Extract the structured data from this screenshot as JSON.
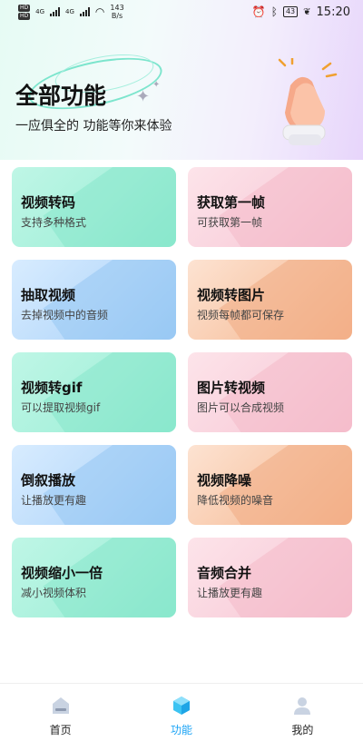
{
  "status_bar": {
    "hd1": "HD",
    "hd2": "HD",
    "net1": "4G",
    "net2": "4G",
    "speed_value": "143",
    "speed_unit": "B/s",
    "battery": "43",
    "time": "15:20"
  },
  "hero": {
    "title": "全部功能",
    "subtitle": "一应俱全的 功能等你来体验"
  },
  "features": [
    {
      "title": "视频转码",
      "desc": "支持多种格式",
      "color": "teal"
    },
    {
      "title": "获取第一帧",
      "desc": "可获取第一帧",
      "color": "pink"
    },
    {
      "title": "抽取视频",
      "desc": "去掉视频中的音频",
      "color": "blue"
    },
    {
      "title": "视频转图片",
      "desc": "视频每帧都可保存",
      "color": "peach"
    },
    {
      "title": "视频转gif",
      "desc": "可以提取视频gif",
      "color": "teal"
    },
    {
      "title": "图片转视频",
      "desc": "图片可以合成视频",
      "color": "pink"
    },
    {
      "title": "倒叙播放",
      "desc": "让播放更有趣",
      "color": "blue"
    },
    {
      "title": "视频降噪",
      "desc": "降低视频的噪音",
      "color": "peach"
    },
    {
      "title": "视频缩小一倍",
      "desc": "减小视频体积",
      "color": "teal"
    },
    {
      "title": "音频合并",
      "desc": "让播放更有趣",
      "color": "pink"
    }
  ],
  "tabs": [
    {
      "label": "首页",
      "icon": "home-icon",
      "active": false
    },
    {
      "label": "功能",
      "icon": "cube-icon",
      "active": true
    },
    {
      "label": "我的",
      "icon": "user-icon",
      "active": false
    }
  ],
  "colors": {
    "active_tab": "#1aa3f5",
    "teal": "#a9f1dc",
    "pink": "#f9d2dd",
    "blue": "#bcdcfb",
    "peach": "#f8c9ab"
  }
}
